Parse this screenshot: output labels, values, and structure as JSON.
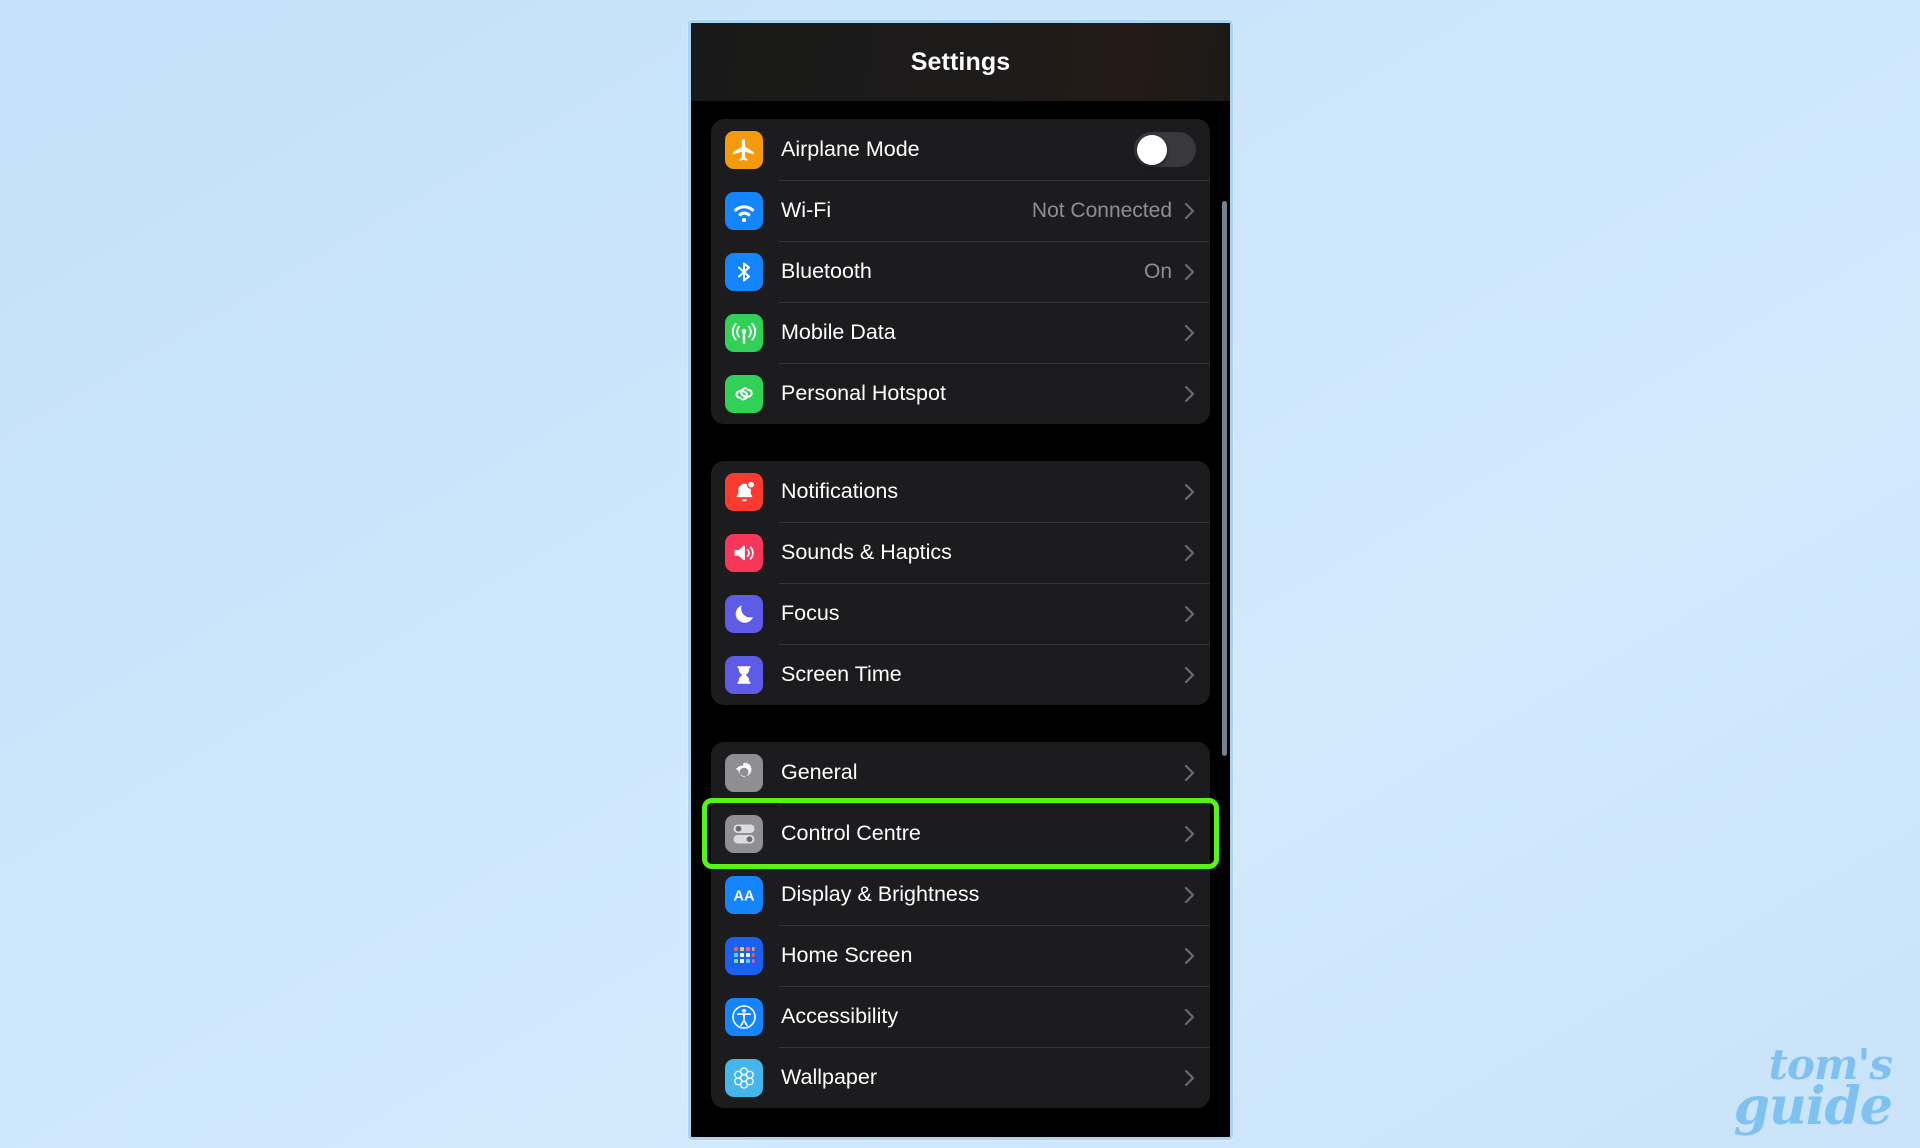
{
  "background": {
    "color": "#c9e3fa"
  },
  "phone": {
    "nav": {
      "title": "Settings"
    },
    "groups": [
      {
        "id": "connectivity",
        "rows": [
          {
            "label": "Airplane Mode",
            "icon": "airplane-icon",
            "icon_bg": "#f59a0b",
            "control": "toggle",
            "toggle_on": false
          },
          {
            "label": "Wi-Fi",
            "icon": "wifi-icon",
            "icon_bg": "#1484ff",
            "control": "chevron",
            "value": "Not Connected"
          },
          {
            "label": "Bluetooth",
            "icon": "bluetooth-icon",
            "icon_bg": "#1484ff",
            "control": "chevron",
            "value": "On"
          },
          {
            "label": "Mobile Data",
            "icon": "cellular-icon",
            "icon_bg": "#31d158",
            "control": "chevron",
            "value": ""
          },
          {
            "label": "Personal Hotspot",
            "icon": "hotspot-icon",
            "icon_bg": "#31d158",
            "control": "chevron",
            "value": ""
          }
        ]
      },
      {
        "id": "alerts",
        "rows": [
          {
            "label": "Notifications",
            "icon": "bell-icon",
            "icon_bg": "#fb3b30",
            "control": "chevron",
            "value": ""
          },
          {
            "label": "Sounds & Haptics",
            "icon": "speaker-icon",
            "icon_bg": "#f8365a",
            "control": "chevron",
            "value": ""
          },
          {
            "label": "Focus",
            "icon": "moon-icon",
            "icon_bg": "#5e5ce6",
            "control": "chevron",
            "value": ""
          },
          {
            "label": "Screen Time",
            "icon": "hourglass-icon",
            "icon_bg": "#5e5ce6",
            "control": "chevron",
            "value": ""
          }
        ]
      },
      {
        "id": "system",
        "rows": [
          {
            "label": "General",
            "icon": "gear-icon",
            "icon_bg": "#8e8e93",
            "control": "chevron",
            "value": ""
          },
          {
            "label": "Control Centre",
            "icon": "control-centre-icon",
            "icon_bg": "#8e8e93",
            "control": "chevron",
            "value": "",
            "highlighted": true
          },
          {
            "label": "Display & Brightness",
            "icon": "aa-text-icon",
            "icon_bg": "#1484ff",
            "control": "chevron",
            "value": ""
          },
          {
            "label": "Home Screen",
            "icon": "home-screen-grid-icon",
            "icon_bg": "#1b61f0",
            "control": "chevron",
            "value": ""
          },
          {
            "label": "Accessibility",
            "icon": "accessibility-icon",
            "icon_bg": "#1484ff",
            "control": "chevron",
            "value": ""
          },
          {
            "label": "Wallpaper",
            "icon": "wallpaper-flower-icon",
            "icon_bg": "#45b5ea",
            "control": "chevron",
            "value": ""
          }
        ]
      }
    ]
  },
  "highlight": {
    "color": "#58f415",
    "target_label": "Control Centre"
  },
  "watermark": {
    "line1": "tom's",
    "line2": "guide",
    "color": "#7fc2f2"
  }
}
